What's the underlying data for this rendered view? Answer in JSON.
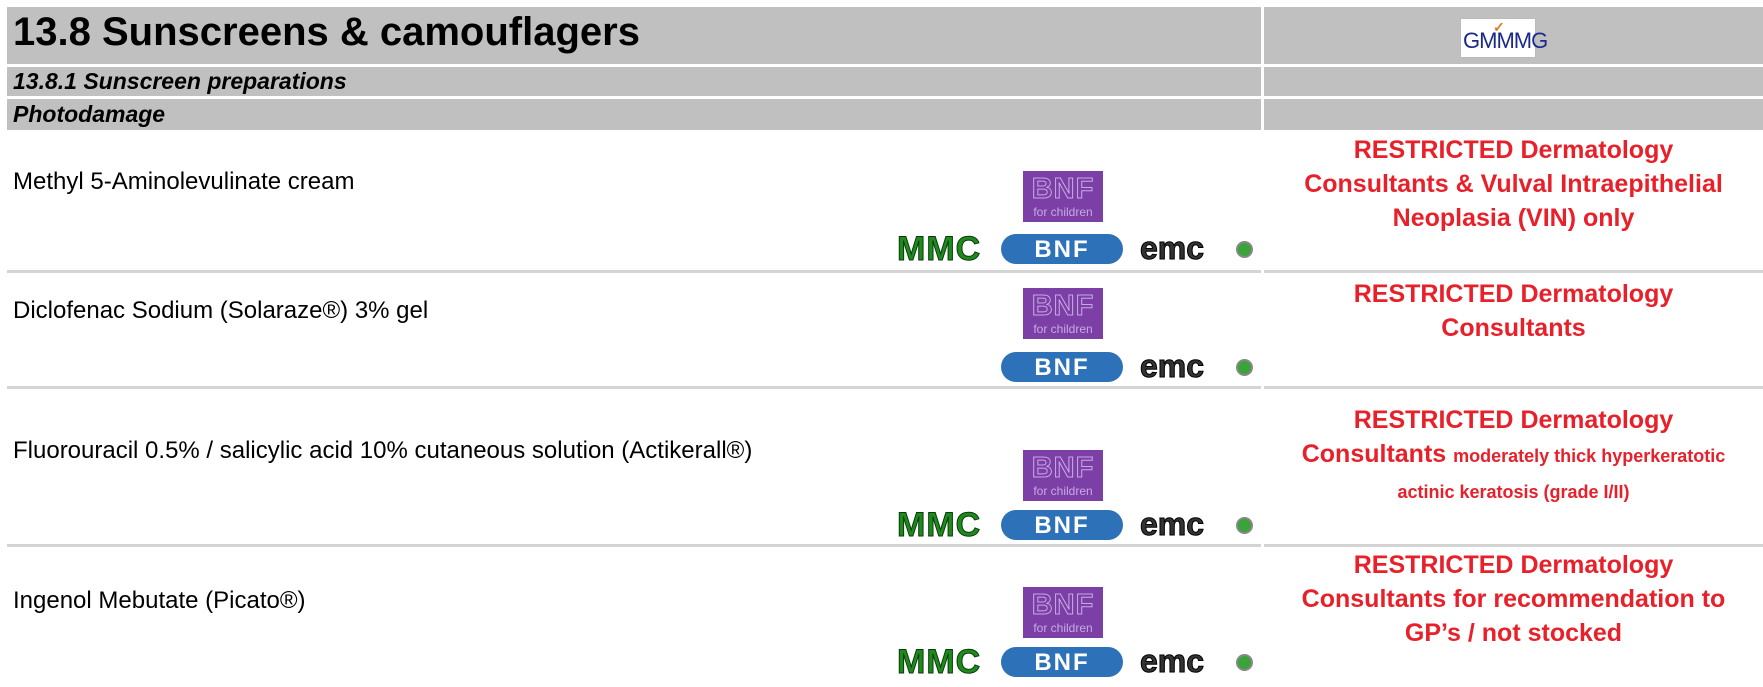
{
  "header": {
    "title": "13.8 Sunscreens & camouflagers",
    "logo_text": "GMMMG",
    "section": "13.8.1 Sunscreen preparations",
    "subsection": "Photodamage"
  },
  "icons": {
    "bnfc_main": "BNF",
    "bnfc_sub": "for children",
    "mmc": "MMC",
    "bnf": "BNF",
    "emc": "emc"
  },
  "drugs": [
    {
      "name": "Methyl 5-Aminolevulinate cream",
      "restriction_caps": "RESTRICTED",
      "restriction_lines": [
        "Dermatology",
        "Consultants & Vulval Intraepithelial",
        "Neoplasia (VIN) only"
      ]
    },
    {
      "name": "Diclofenac Sodium (Solaraze®) 3% gel",
      "restriction_caps": "RESTRICTED",
      "restriction_lines": [
        "Dermatology",
        "Consultants"
      ]
    },
    {
      "name": "Fluorouracil 0.5% / salicylic acid 10% cutaneous solution (Actikerall®)",
      "restriction_caps": "RESTRICTED",
      "restriction_lines": [
        "Dermatology",
        "Consultants",
        "moderately thick hyperkeratotic",
        "actinic keratosis (grade I/II)"
      ]
    },
    {
      "name": "Ingenol Mebutate (Picato®)",
      "restriction_caps": "RESTRICTED",
      "restriction_lines": [
        "Dermatology",
        "Consultants for recommendation to",
        "GP’s / not stocked"
      ]
    }
  ],
  "colors": {
    "header_bg": "#c0c0c0",
    "restriction_red": "#e8202a",
    "bnfc_purple": "#7b3fa6",
    "bnf_blue": "#2d72b8",
    "mmc_green": "#1e8a1e"
  }
}
